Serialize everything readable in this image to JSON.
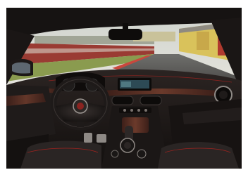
{
  "image": {
    "subject": "car-interior-photo",
    "colors": {
      "sky": "#d7d9d4",
      "dashboard": "#1b1716",
      "wood_trim": "#5a2f24",
      "leather": "#2a2524",
      "red_stitch": "#a3231f",
      "track_red": "#b3403a",
      "grass": "#8a9b4f",
      "screen": "#2d4a55"
    }
  }
}
